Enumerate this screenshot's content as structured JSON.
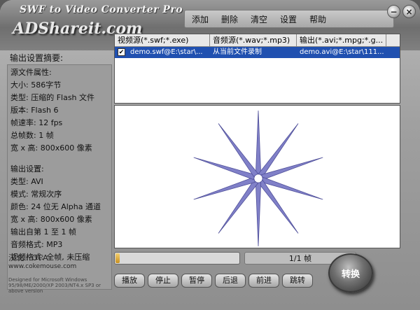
{
  "window": {
    "app_title": "SWF to Video Converter Pro",
    "brand": "ADShareit.com",
    "minimize_glyph": "−",
    "close_glyph": "×"
  },
  "menu": [
    {
      "label": "添加"
    },
    {
      "label": "删除"
    },
    {
      "label": "清空"
    },
    {
      "label": "设置"
    },
    {
      "label": "帮助"
    }
  ],
  "summary": {
    "title": "输出设置摘要:",
    "source_lines": [
      "源文件属性:",
      "大小: 586字节",
      "类型: 压缩的 Flash 文件",
      "版本: Flash 6",
      "帧速率: 12 fps",
      "总帧数: 1 帧",
      "宽 x 高: 800x600 像素"
    ],
    "output_lines": [
      "输出设置:",
      "类型: AVI",
      "模式: 常规次序",
      "颜色: 24 位无 Alpha 通道",
      "宽 x 高: 800x600 像素",
      "输出自第 1 至 1 帧",
      "音频格式: MP3",
      "视频格式: 全帧, 未压缩"
    ]
  },
  "credits": {
    "localized": "汉化: OFA",
    "site": "www.cokemouse.com",
    "designed": "Designed for Microsoft Windows 95/98/ME/2000/XP 2003/NT4.x SP3 or above version"
  },
  "file_list": {
    "columns": [
      "视频源(*.swf;*.exe)",
      "音频源(*.wav;*.mp3)",
      "输出(*.avi;*.mpg;*.g..."
    ],
    "rows": [
      {
        "checked": "✔",
        "video": "demo.swf@E:\\star\\...",
        "audio": "从当前文件录制",
        "output": "demo.avi@E:\\star\\111..."
      }
    ]
  },
  "status": {
    "progress": 0.02,
    "frame_count": "1/1 帧"
  },
  "controls": [
    {
      "label": "播放"
    },
    {
      "label": "停止"
    },
    {
      "label": "暂停"
    },
    {
      "label": "后退"
    },
    {
      "label": "前进"
    },
    {
      "label": "跳转"
    }
  ],
  "convert_label": "转换",
  "colors": {
    "star_fill": "#8080c8",
    "star_stroke": "#50509a",
    "selection": "#2050b0"
  }
}
